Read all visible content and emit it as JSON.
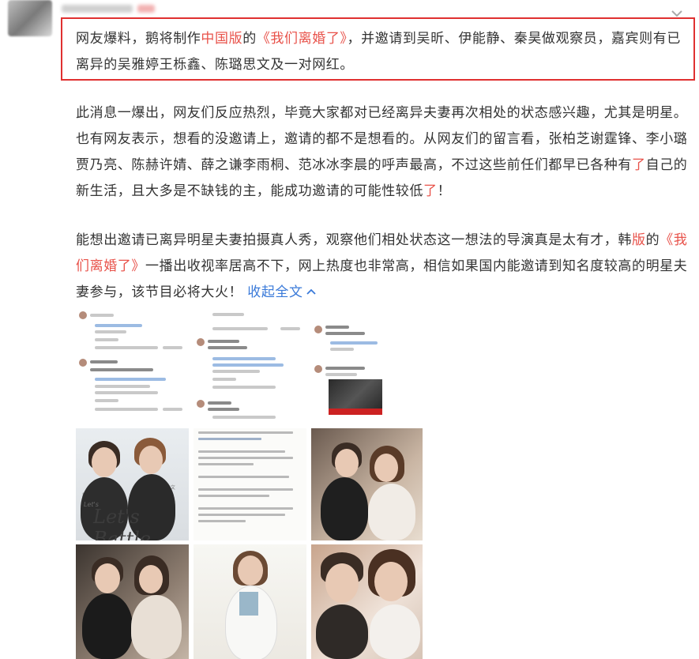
{
  "post": {
    "highlighted": {
      "before": "网友爆料，鹅将制作",
      "red1": "中国版",
      "mid1": "的",
      "red2": "《我们离婚了》",
      "after": "，并邀请到吴昕、伊能静、秦昊做观察员，嘉宾则有已离异的吴雅婷王栎鑫、陈璐思文及一对网红。"
    },
    "para2": {
      "t1": "此消息一爆出，网友们反应热烈，毕竟大家都对已经离异夫妻再次相处的状态感兴趣，尤其是明星。也有网友表示，想看的没邀请上，邀请的都不是想看的。从网友们的留言看，张柏芝谢霆锋、李小璐贾乃亮、陈赫许婧、薛之谦李雨桐、范冰冰李晨的呼声最高，不过这些前任们都早已各种有",
      "red1": "了",
      "t2": "自己的新生活，且大多是不缺钱的主，能成功邀请的可能性较低",
      "red2": "了",
      "t3": "！"
    },
    "para3": {
      "t1": "能想出邀请已离异明星夫妻拍摄真人秀，观察他们相处状态这一想法的导演真是太有才，韩",
      "red1": "版",
      "t2": "的",
      "red2": "《我们离婚了》",
      "t3": "一播出收视率居高不下，网上热度也非常高，相信如果国内能邀请到知名度较高的明星夫妻参与，该节目必将大火！",
      "collapse_label": "收起全文",
      "collapse_icon": "chevron-up-icon"
    },
    "header_icon": "chevron-down-icon",
    "colors": {
      "red": "#e8524a",
      "box": "#e03030",
      "link": "#3a7ad9",
      "text": "#333333"
    }
  },
  "gallery": {
    "poster_title": "Let's Battle"
  }
}
